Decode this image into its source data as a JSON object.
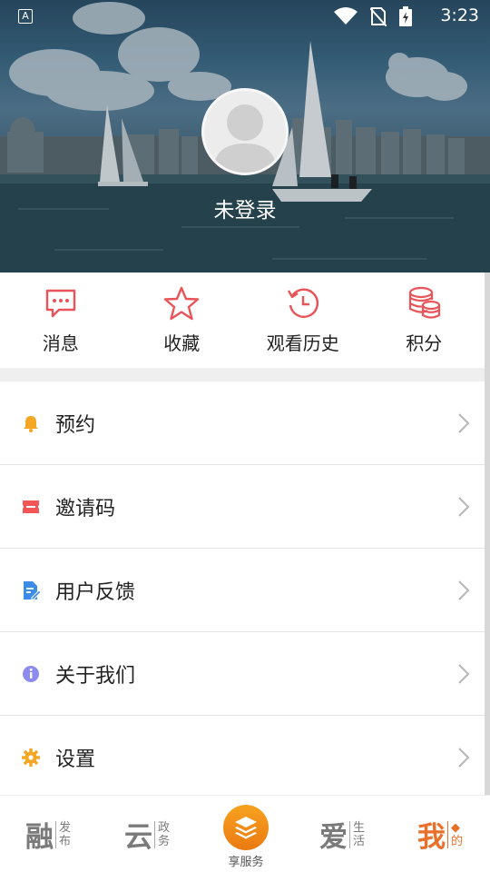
{
  "status_bar": {
    "notification_icon_letter": "A",
    "time": "3:23",
    "icons": [
      "wifi-icon",
      "no-sim-icon",
      "battery-icon"
    ]
  },
  "header": {
    "login_text": "未登录"
  },
  "quick_actions": [
    {
      "label": "消息",
      "icon": "message-icon"
    },
    {
      "label": "收藏",
      "icon": "star-icon"
    },
    {
      "label": "观看历史",
      "icon": "history-icon"
    },
    {
      "label": "积分",
      "icon": "coins-icon"
    }
  ],
  "menu": [
    {
      "label": "预约",
      "icon": "bell-icon",
      "color": "#f5a623"
    },
    {
      "label": "邀请码",
      "icon": "ticket-icon",
      "color": "#f25656"
    },
    {
      "label": "用户反馈",
      "icon": "feedback-edit-icon",
      "color": "#3d8de8"
    },
    {
      "label": "关于我们",
      "icon": "info-icon",
      "color": "#8c8cf0"
    },
    {
      "label": "设置",
      "icon": "gear-icon",
      "color": "#f5a623"
    }
  ],
  "bottom_nav": {
    "tabs": [
      {
        "big": "融",
        "small1": "发",
        "small2": "布"
      },
      {
        "big": "云",
        "small1": "政",
        "small2": "务"
      },
      {
        "center_label": "享服务"
      },
      {
        "big": "爱",
        "small1": "生",
        "small2": "活"
      },
      {
        "big": "我",
        "small1": "◆",
        "small2": "的"
      }
    ],
    "active_color": "#e8702a"
  },
  "colors": {
    "accent": "#e8702a",
    "quick_icon": "#e8545a"
  }
}
